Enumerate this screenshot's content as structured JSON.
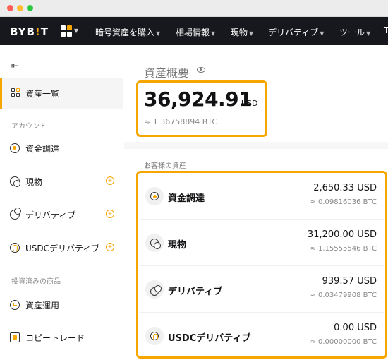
{
  "brand": {
    "logo": "BYB!T",
    "accent": "#f7a600",
    "nav_bg": "#17181e"
  },
  "nav": {
    "items": [
      {
        "label": "暗号資産を購入"
      },
      {
        "label": "相場情報"
      },
      {
        "label": "現物"
      },
      {
        "label": "デリバティブ"
      },
      {
        "label": "ツール"
      }
    ],
    "edge_char": "T"
  },
  "sidebar": {
    "items": [
      {
        "label": "資産一覧",
        "icon": "grid-icon",
        "active": true
      },
      {
        "label": "資金調達",
        "icon": "coin-icon"
      },
      {
        "label": "現物",
        "icon": "spot-icon"
      },
      {
        "label": "デリバティブ",
        "icon": "derivatives-icon"
      },
      {
        "label": "USDCデリバティブ",
        "icon": "usdc-icon"
      },
      {
        "label": "資産運用",
        "icon": "earn-icon"
      },
      {
        "label": "コピートレード",
        "icon": "copy-trade-icon"
      }
    ],
    "sections": [
      {
        "label": "アカウント"
      },
      {
        "label": "投資済みの商品"
      }
    ]
  },
  "overview": {
    "title": "資産概要",
    "total_value": "36,924.91",
    "total_currency": "USD",
    "total_btc": "≈ 1.36758894 BTC"
  },
  "assets": {
    "label": "お客様の資産",
    "rows": [
      {
        "name": "資金調達",
        "value": "2,650.33 USD",
        "btc": "≈ 0.09816036 BTC",
        "icon": "coin-icon"
      },
      {
        "name": "現物",
        "value": "31,200.00 USD",
        "btc": "≈ 1.15555546 BTC",
        "icon": "spot-icon"
      },
      {
        "name": "デリバティブ",
        "value": "939.57 USD",
        "btc": "≈ 0.03479908 BTC",
        "icon": "derivatives-icon"
      },
      {
        "name": "USDCデリバティブ",
        "value": "0.00 USD",
        "btc": "≈ 0.00000000 BTC",
        "icon": "usdc-icon"
      }
    ]
  }
}
